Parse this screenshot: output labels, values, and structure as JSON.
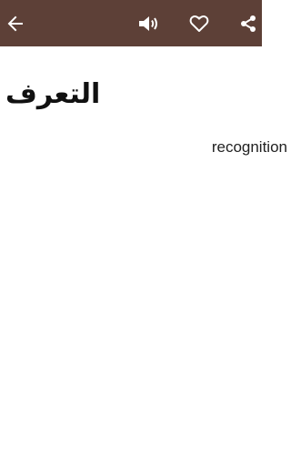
{
  "toolbar": {
    "background": "#5d4037",
    "icons": [
      "back-arrow-icon",
      "speaker-icon",
      "heart-icon",
      "share-icon"
    ]
  },
  "entry": {
    "word": "التعرف",
    "translation": "recognition"
  }
}
